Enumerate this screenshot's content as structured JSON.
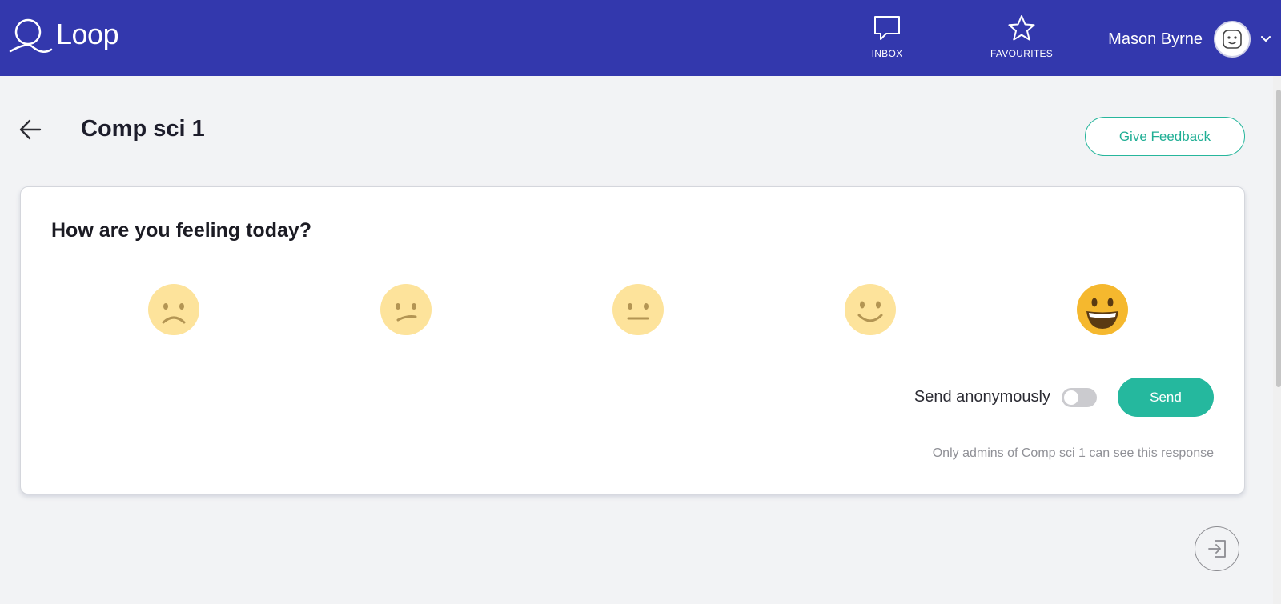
{
  "app": {
    "name": "Loop"
  },
  "nav": {
    "inbox_label": "INBOX",
    "favourites_label": "FAVOURITES"
  },
  "user": {
    "name": "Mason Byrne"
  },
  "page": {
    "title": "Comp sci 1",
    "give_feedback_label": "Give Feedback"
  },
  "survey": {
    "question": "How are you feeling today?",
    "moods": [
      {
        "name": "very-sad",
        "selected": false
      },
      {
        "name": "sad",
        "selected": false
      },
      {
        "name": "neutral",
        "selected": false
      },
      {
        "name": "happy",
        "selected": false
      },
      {
        "name": "very-happy",
        "selected": true
      }
    ],
    "anonymous_label": "Send anonymously",
    "anonymous_enabled": false,
    "send_label": "Send",
    "privacy_note": "Only admins of Comp sci 1 can see this response"
  },
  "colors": {
    "header": "#3338ad",
    "accent": "#25b89e",
    "mood_inactive": "#fde39b",
    "mood_selected": "#f5b82e"
  },
  "icons": {
    "logo": "loop-logo-icon",
    "inbox": "chat-bubble-icon",
    "favourites": "star-icon",
    "avatar": "robot-face-icon",
    "menu": "chevron-down-icon",
    "back": "arrow-left-icon",
    "exit": "exit-icon"
  }
}
